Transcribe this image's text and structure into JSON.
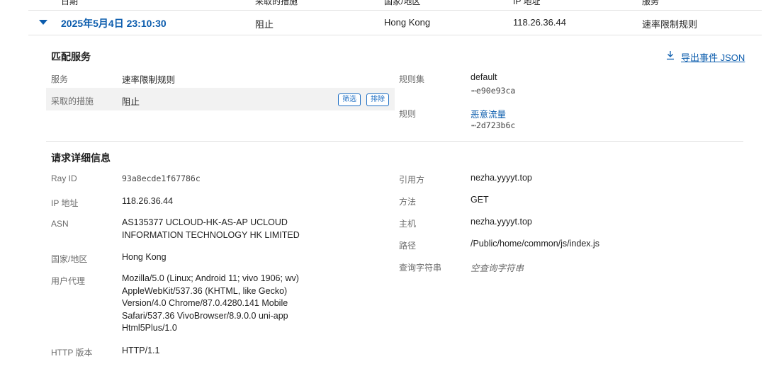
{
  "table_header": {
    "date": "日期",
    "action": "采取的措施",
    "country": "国家/地区",
    "ip": "IP 地址",
    "service": "服务"
  },
  "event_row": {
    "date": "2025年5月4日 23:10:30",
    "action": "阻止",
    "country": "Hong Kong",
    "ip": "118.26.36.44",
    "service": "速率限制规则"
  },
  "matched_service": {
    "title": "匹配服务",
    "export_label": "导出事件 JSON",
    "service_label": "服务",
    "service_value": "速率限制规则",
    "action_label": "采取的措施",
    "action_value": "阻止",
    "filter_button": "筛选",
    "exclude_button": "排除",
    "ruleset_label": "规则集",
    "ruleset_value": "default",
    "ruleset_id": "⋯e90e93ca",
    "rule_label": "规则",
    "rule_value": "恶意流量",
    "rule_id": "⋯2d723b6c"
  },
  "request_details": {
    "title": "请求详细信息",
    "rayid_label": "Ray ID",
    "rayid_value": "93a8ecde1f67786c",
    "ip_label": "IP 地址",
    "ip_value": "118.26.36.44",
    "asn_label": "ASN",
    "asn_value": "AS135377 UCLOUD-HK-AS-AP UCLOUD INFORMATION TECHNOLOGY HK LIMITED",
    "country_label": "国家/地区",
    "country_value": "Hong Kong",
    "ua_label": "用户代理",
    "ua_value": "Mozilla/5.0 (Linux; Android 11; vivo 1906; wv) AppleWebKit/537.36 (KHTML, like Gecko) Version/4.0 Chrome/87.0.4280.141 Mobile Safari/537.36 VivoBrowser/8.9.0.0 uni-app Html5Plus/1.0",
    "http_label": "HTTP 版本",
    "http_value": "HTTP/1.1",
    "referer_label": "引用方",
    "referer_value": "nezha.yyyyt.top",
    "method_label": "方法",
    "method_value": "GET",
    "host_label": "主机",
    "host_value": "nezha.yyyyt.top",
    "path_label": "路径",
    "path_value": "/Public/home/common/js/index.js",
    "query_label": "查询字符串",
    "query_value": "空查询字符串"
  },
  "colors": {
    "accent": "#0b5cad",
    "highlight_bg": "#f2f2f2"
  }
}
